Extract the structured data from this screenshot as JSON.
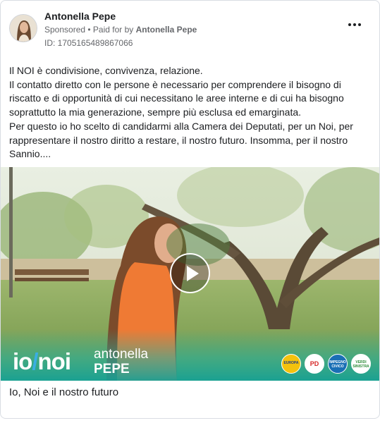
{
  "post": {
    "author": "Antonella Pepe",
    "sponsored": "Sponsored",
    "paid_prefix": "• Paid for by",
    "paid_by": "Antonella Pepe",
    "ad_id": "ID: 1705165489867066",
    "body_lines": [
      "Il NOI è condivisione, convivenza, relazione.",
      "Il contatto diretto con le persone è necessario per comprendere il bisogno di riscatto e di opportunità di cui necessitano le aree interne e di cui ha bisogno soprattutto la mia generazione, sempre più esclusa ed emarginata.",
      "Per questo io ho scelto di candidarmi alla Camera dei Deputati, per un Noi, per rappresentare il nostro diritto a restare, il nostro futuro. Insomma, per il nostro Sannio...."
    ],
    "caption": "Io, Noi e il nostro futuro"
  },
  "video_overlay": {
    "logo_io": "io",
    "logo_slash": "/",
    "logo_noi": "noi",
    "name": "antonella",
    "surname": "PEPE",
    "party_badges": [
      {
        "icon": "europa-badge",
        "label": "EUROPA",
        "color": "#f4c20d"
      },
      {
        "icon": "pd-badge",
        "label": "PD",
        "color": "#ffffff"
      },
      {
        "icon": "impegno-civico-badge",
        "label": "IMPEGNO CIVICO",
        "color": "#1a6fb5"
      },
      {
        "icon": "verdi-sinistra-badge",
        "label": "VERDI SINISTRA",
        "color": "#ffffff"
      }
    ]
  },
  "colors": {
    "accent_blue": "#3aaee3",
    "overlay_teal": "#1bb4a8"
  }
}
